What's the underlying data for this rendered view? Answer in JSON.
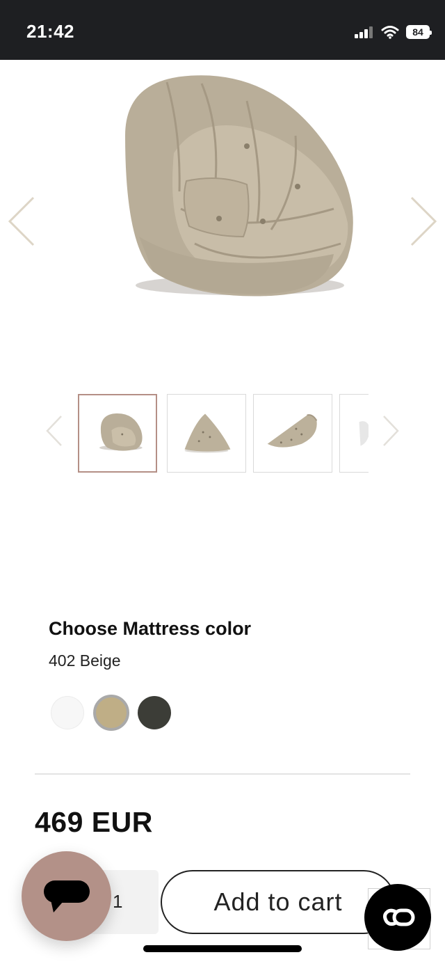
{
  "status_bar": {
    "time": "21:42",
    "battery": "84",
    "icons": [
      "signal-icon",
      "wifi-icon",
      "battery-icon"
    ]
  },
  "gallery": {
    "main_image": "beige-futon-lounge-chair",
    "prev_icon": "chevron-left-icon",
    "next_icon": "chevron-right-icon",
    "thumbnails": [
      {
        "name": "chair-view",
        "active": true
      },
      {
        "name": "folded-triangle-view",
        "active": false
      },
      {
        "name": "unfolded-half-moon-view",
        "active": false
      },
      {
        "name": "white-variant-view",
        "active": false
      }
    ]
  },
  "color": {
    "title": "Choose Mattress color",
    "selected": "402 Beige",
    "swatches": [
      {
        "name": "white",
        "hex": "#f7f7f7"
      },
      {
        "name": "beige",
        "hex": "#bfae86",
        "selected": true
      },
      {
        "name": "dark-grey",
        "hex": "#3c3d37"
      }
    ]
  },
  "price": "469 EUR",
  "cart": {
    "quantity": "1",
    "add_label": "Add to cart"
  },
  "colors": {
    "accent": "#b39188",
    "status_bar": "#1e1f22"
  }
}
